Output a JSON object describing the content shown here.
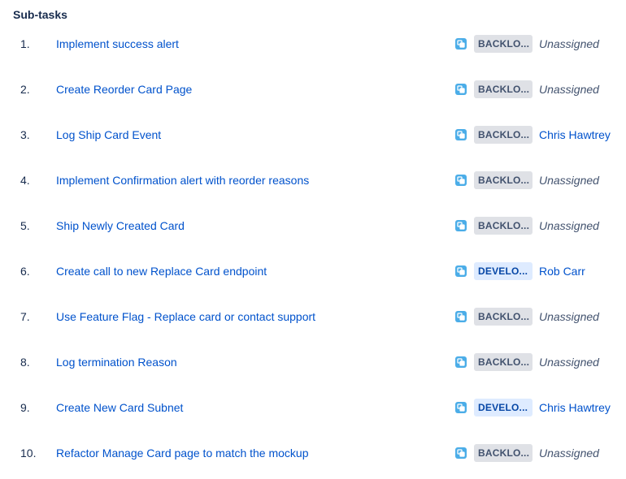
{
  "section": {
    "title": "Sub-tasks"
  },
  "colors": {
    "link": "#0052cc",
    "text": "#172b4d",
    "subtask_icon": "#4bade8",
    "status_backlog_bg": "#dfe1e6",
    "status_backlog_text": "#42526e",
    "status_develop_bg": "#deebff",
    "status_develop_text": "#0747a6"
  },
  "subtasks": [
    {
      "number": "1.",
      "summary": "Implement success alert",
      "icon": "subtask-icon",
      "status": "BACKLO...",
      "status_kind": "backlog",
      "assignee": "Unassigned",
      "assigned": false
    },
    {
      "number": "2.",
      "summary": "Create Reorder Card Page",
      "icon": "subtask-icon",
      "status": "BACKLO...",
      "status_kind": "backlog",
      "assignee": "Unassigned",
      "assigned": false
    },
    {
      "number": "3.",
      "summary": "Log Ship Card Event",
      "icon": "subtask-icon",
      "status": "BACKLO...",
      "status_kind": "backlog",
      "assignee": "Chris Hawtrey",
      "assigned": true
    },
    {
      "number": "4.",
      "summary": "Implement Confirmation alert with reorder reasons",
      "icon": "subtask-icon",
      "status": "BACKLO...",
      "status_kind": "backlog",
      "assignee": "Unassigned",
      "assigned": false
    },
    {
      "number": "5.",
      "summary": "Ship Newly Created Card",
      "icon": "subtask-icon",
      "status": "BACKLO...",
      "status_kind": "backlog",
      "assignee": "Unassigned",
      "assigned": false
    },
    {
      "number": "6.",
      "summary": "Create call to new Replace Card endpoint",
      "icon": "subtask-icon",
      "status": "DEVELO...",
      "status_kind": "develop",
      "assignee": "Rob Carr",
      "assigned": true
    },
    {
      "number": "7.",
      "summary": "Use Feature Flag - Replace card or contact support",
      "icon": "subtask-icon",
      "status": "BACKLO...",
      "status_kind": "backlog",
      "assignee": "Unassigned",
      "assigned": false
    },
    {
      "number": "8.",
      "summary": "Log termination Reason",
      "icon": "subtask-icon",
      "status": "BACKLO...",
      "status_kind": "backlog",
      "assignee": "Unassigned",
      "assigned": false
    },
    {
      "number": "9.",
      "summary": "Create New Card Subnet",
      "icon": "subtask-icon",
      "status": "DEVELO...",
      "status_kind": "develop",
      "assignee": "Chris Hawtrey",
      "assigned": true
    },
    {
      "number": "10.",
      "summary": "Refactor Manage Card page to match the mockup",
      "icon": "subtask-icon",
      "status": "BACKLO...",
      "status_kind": "backlog",
      "assignee": "Unassigned",
      "assigned": false
    }
  ]
}
